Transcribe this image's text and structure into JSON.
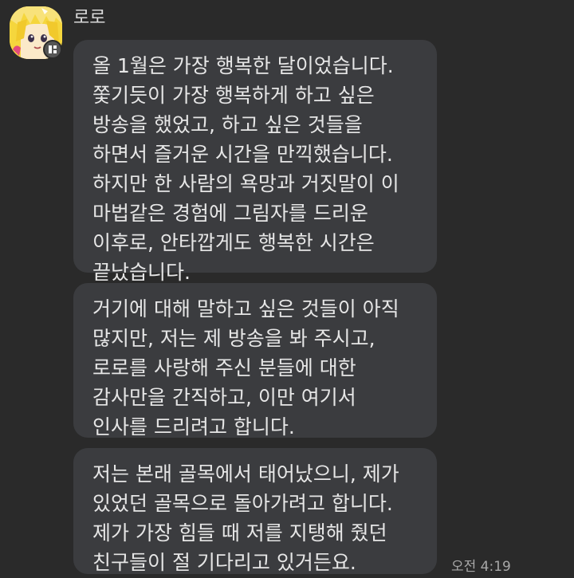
{
  "sender": {
    "name": "로로",
    "avatar_icon": "blonde-character-avatar",
    "badge_icon": "profile-badge-icon"
  },
  "messages": [
    {
      "lines": [
        "올 1월은 가장 행복한 달이었습니다.",
        "쫓기듯이 가장 행복하게 하고 싶은",
        "방송을 했었고, 하고 싶은 것들을",
        "하면서 즐거운 시간을 만끽했습니다.",
        "하지만 한 사람의 욕망과 거짓말이 이",
        "마법같은 경험에 그림자를 드리운",
        "이후로, 안타깝게도 행복한 시간은",
        "끝났습니다."
      ]
    },
    {
      "lines": [
        "거기에 대해 말하고 싶은 것들이 아직",
        "많지만, 저는 제 방송을 봐 주시고,",
        "로로를 사랑해 주신 분들에 대한",
        "감사만을 간직하고, 이만 여기서",
        "인사를 드리려고 합니다."
      ]
    },
    {
      "lines": [
        "저는 본래 골목에서 태어났으니, 제가",
        "있었던 골목으로 돌아가려고 합니다.",
        "제가 가장 힘들 때 저를 지탱해 줬던",
        "친구들이 절 기다리고 있거든요."
      ]
    }
  ],
  "timestamp": "오전 4:19",
  "colors": {
    "background": "#2a2a2a",
    "bubble": "#3b3c3f",
    "text": "#e6e6e6",
    "timestamp": "#a8a8a8"
  }
}
